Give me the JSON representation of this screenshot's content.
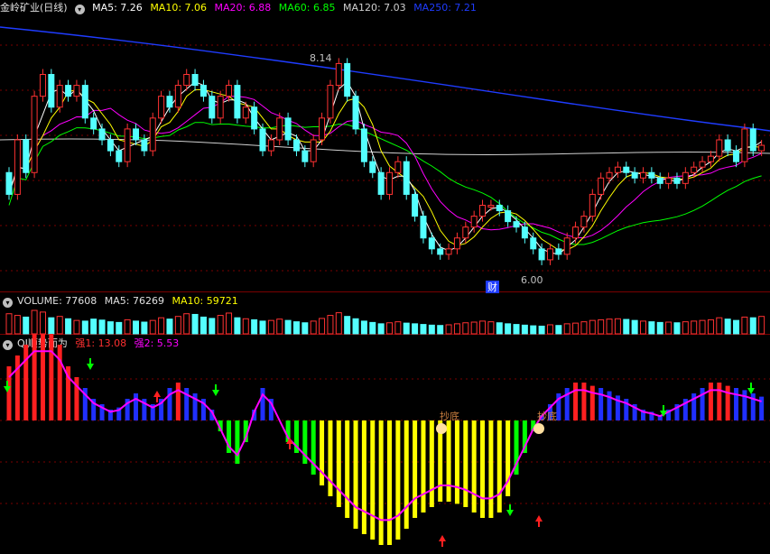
{
  "main": {
    "title": "金岭矿业(日线)",
    "ma": [
      {
        "label": "MA5: 7.26",
        "color": "#ffffff"
      },
      {
        "label": "MA10: 7.06",
        "color": "#ffff00"
      },
      {
        "label": "MA20: 6.88",
        "color": "#ff00ff"
      },
      {
        "label": "MA60: 6.85",
        "color": "#00ff00"
      },
      {
        "label": "MA120: 7.03",
        "color": "#d0d0d0"
      },
      {
        "label": "MA250: 7.21",
        "color": "#1f3cff"
      }
    ],
    "high_label": "8.14",
    "low_label": "6.00",
    "badge": "财"
  },
  "volume": {
    "title": "VOLUME: 77608",
    "ma5": "MA5: 76269",
    "ma10": "MA10: 59721"
  },
  "indicator": {
    "title": "QI顺势而为",
    "strong1": "强1: 13.08",
    "strong2": "强2: 5.53",
    "marks": [
      "抄底",
      "抄底"
    ]
  },
  "colors": {
    "up": "#ff3232",
    "down": "#54ffff",
    "grid": "#7a0000",
    "blue": "#1f3cff",
    "red": "#ff2020",
    "yellow": "#ffff00",
    "green": "#00ff00",
    "magenta": "#ff00ff"
  },
  "chart_data": {
    "type": "candlestick",
    "close": [
      6.6,
      7.1,
      6.8,
      7.5,
      7.7,
      7.4,
      7.6,
      7.5,
      7.6,
      7.3,
      7.2,
      7.1,
      7.0,
      6.9,
      7.2,
      7.1,
      7.0,
      7.3,
      7.5,
      7.4,
      7.6,
      7.7,
      7.6,
      7.5,
      7.3,
      7.5,
      7.6,
      7.3,
      7.4,
      7.2,
      7.0,
      7.1,
      7.3,
      7.1,
      7.0,
      6.9,
      7.1,
      7.3,
      7.6,
      7.8,
      7.5,
      7.2,
      6.9,
      6.8,
      6.6,
      6.8,
      6.9,
      6.6,
      6.4,
      6.2,
      6.1,
      6.05,
      6.1,
      6.2,
      6.3,
      6.4,
      6.5,
      6.5,
      6.45,
      6.35,
      6.3,
      6.2,
      6.1,
      6.0,
      6.1,
      6.05,
      6.2,
      6.3,
      6.4,
      6.6,
      6.75,
      6.8,
      6.85,
      6.8,
      6.75,
      6.8,
      6.75,
      6.7,
      6.75,
      6.7,
      6.8,
      6.85,
      6.9,
      6.95,
      7.1,
      7.0,
      6.9,
      7.2,
      7.0,
      7.05
    ],
    "volume": [
      60,
      55,
      50,
      70,
      65,
      48,
      52,
      45,
      40,
      38,
      44,
      41,
      36,
      34,
      42,
      38,
      35,
      40,
      48,
      44,
      52,
      60,
      58,
      50,
      46,
      55,
      62,
      48,
      45,
      42,
      38,
      40,
      44,
      40,
      36,
      33,
      38,
      46,
      55,
      63,
      52,
      45,
      38,
      34,
      30,
      33,
      36,
      32,
      30,
      28,
      26,
      25,
      27,
      30,
      33,
      35,
      38,
      36,
      33,
      30,
      28,
      26,
      24,
      23,
      27,
      25,
      30,
      32,
      36,
      40,
      42,
      44,
      45,
      43,
      40,
      38,
      36,
      34,
      35,
      33,
      36,
      38,
      40,
      42,
      48,
      44,
      40,
      50,
      48,
      52
    ],
    "indicator": [
      5,
      6,
      7,
      8,
      8,
      8,
      7,
      5,
      4,
      3,
      2,
      1.5,
      1,
      1.2,
      2,
      2.5,
      2,
      1.5,
      2,
      3,
      3.5,
      3,
      2.5,
      2,
      1,
      -1,
      -3,
      -4,
      -2,
      1,
      3,
      2,
      0,
      -2,
      -3,
      -4,
      -5,
      -6,
      -7,
      -8,
      -9,
      -10,
      -10.5,
      -11,
      -11.5,
      -11.5,
      -11,
      -10,
      -9,
      -8.5,
      -8,
      -7.5,
      -7.5,
      -7.7,
      -8,
      -8.5,
      -9,
      -9,
      -8.5,
      -7,
      -5,
      -3,
      -1,
      0.5,
      1.5,
      2.5,
      3,
      3.5,
      3.5,
      3.2,
      3,
      2.7,
      2.3,
      2,
      1.5,
      1,
      0.8,
      0.5,
      1,
      1.5,
      2,
      2.5,
      3,
      3.5,
      3.5,
      3.2,
      3,
      2.8,
      2.5,
      2.2
    ]
  }
}
